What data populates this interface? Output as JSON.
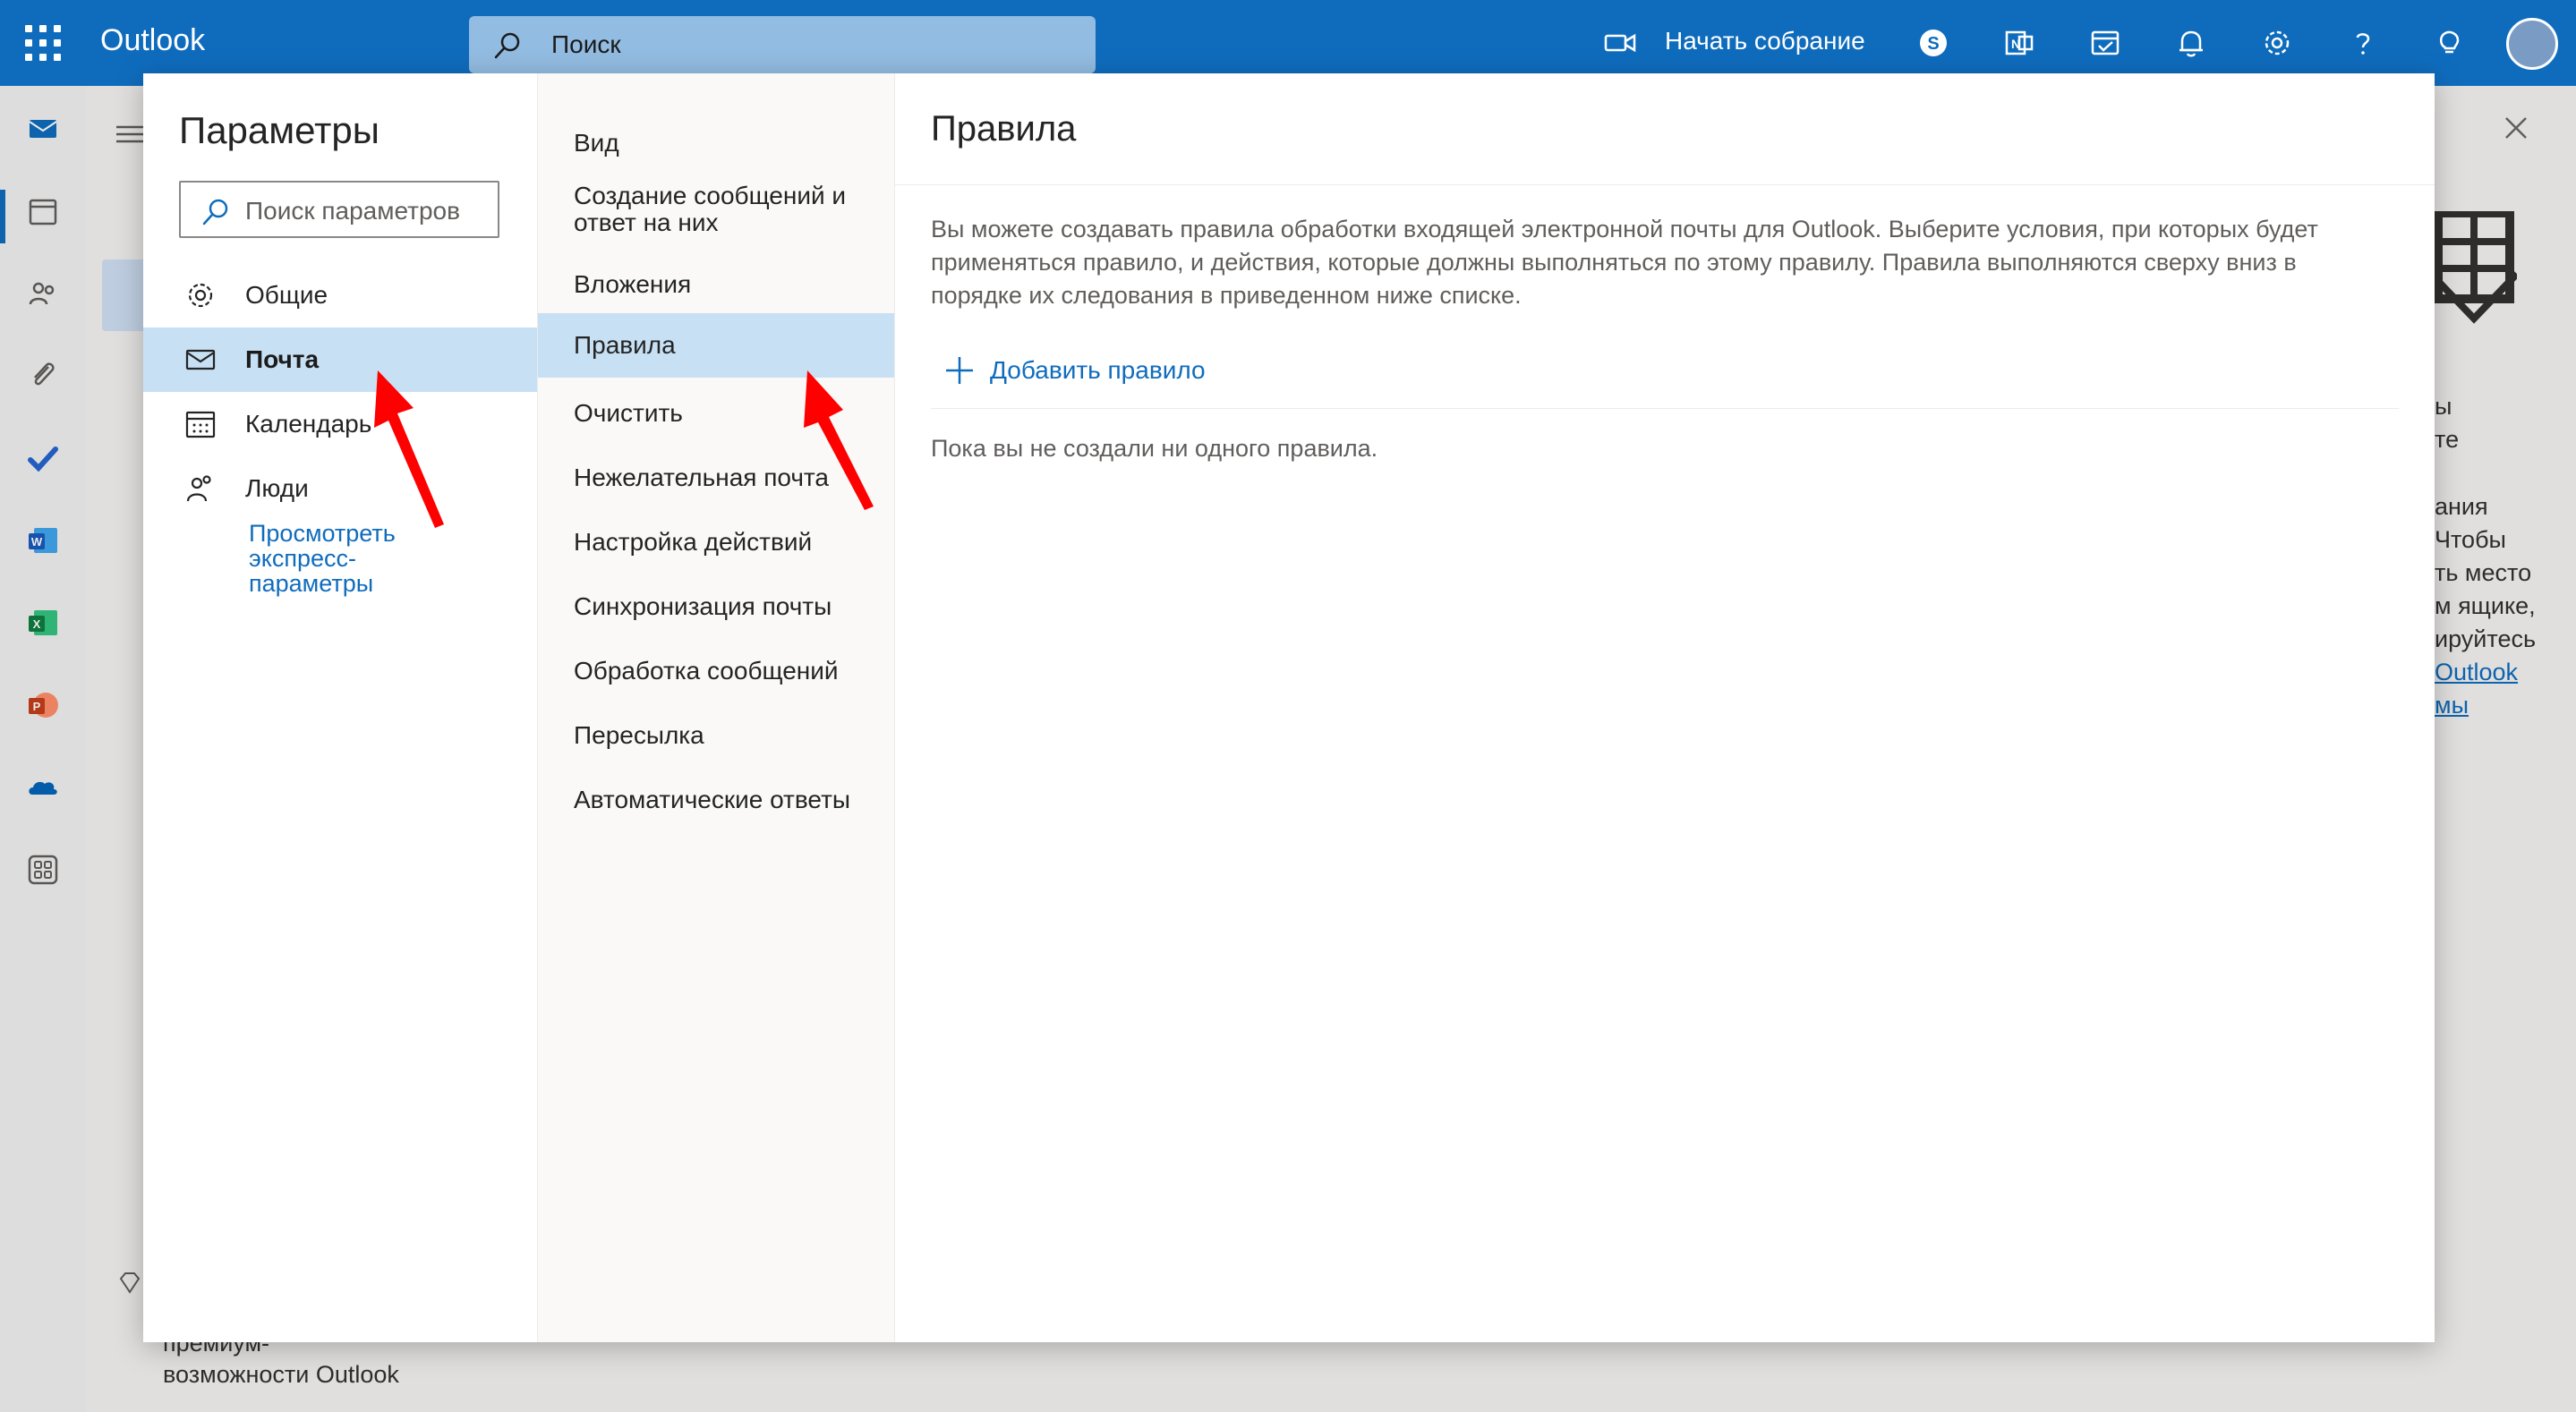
{
  "app": {
    "title": "Outlook"
  },
  "topbar": {
    "search_label": "Поиск",
    "meet_label": "Начать собрание",
    "icons": [
      "waffle-icon",
      "video-icon",
      "skype-icon",
      "teams-icon",
      "todo-icon",
      "bell-icon",
      "gear-icon",
      "help-icon",
      "lightbulb-icon"
    ]
  },
  "rail": {
    "icons": [
      "mail-icon",
      "calendar-icon",
      "people-icon",
      "attachment-icon",
      "todo-icon",
      "word-icon",
      "excel-icon",
      "powerpoint-icon",
      "onedrive-icon",
      "apps-icon"
    ]
  },
  "background": {
    "right_lines": [
      "ы",
      "те",
      "",
      "ания",
      "Чтобы",
      "ть место",
      "м ящике,",
      "ируйтесь"
    ],
    "right_links": [
      "Outlook",
      "мы"
    ],
    "bottom_lines": [
      "премиум-",
      "возможности Outlook"
    ]
  },
  "settings": {
    "title": "Параметры",
    "search_placeholder": "Поиск параметров",
    "categories": [
      {
        "label": "Общие",
        "icon": "gear-icon"
      },
      {
        "label": "Почта",
        "icon": "mail-icon"
      },
      {
        "label": "Календарь",
        "icon": "calendar-icon"
      },
      {
        "label": "Люди",
        "icon": "people-icon"
      }
    ],
    "active_category": "Почта",
    "quick_settings_link": "Просмотреть экспресс-параметры",
    "mail_sections": [
      "Вид",
      "Создание сообщений и ответ на них",
      "Вложения",
      "Правила",
      "Очистить",
      "Нежелательная почта",
      "Настройка действий",
      "Синхронизация почты",
      "Обработка сообщений",
      "Пересылка",
      "Автоматические ответы"
    ],
    "active_section": "Правила"
  },
  "rules": {
    "heading": "Правила",
    "description": "Вы можете создавать правила обработки входящей электронной почты для Outlook. Выберите условия, при которых будет применяться правило, и действия, которые должны выполняться по этому правилу. Правила выполняются сверху вниз в порядке их следования в приведенном ниже списке.",
    "add_rule_label": "Добавить правило",
    "empty_text": "Пока вы не создали ни одного правила."
  },
  "colors": {
    "brand": "#0f6cbd",
    "selection": "#c7e0f4",
    "arrow": "#ff0000"
  }
}
